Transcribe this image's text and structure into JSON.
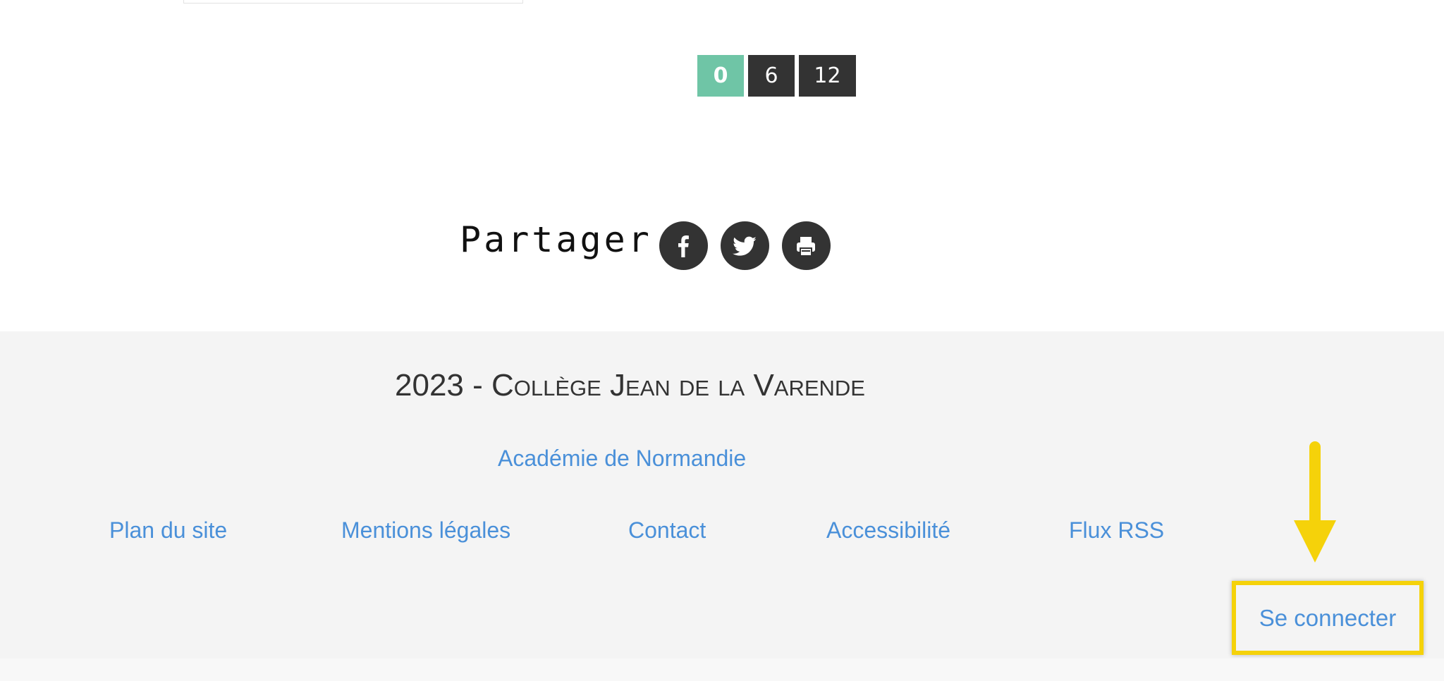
{
  "pagination": {
    "pages": [
      "0",
      "6",
      "12"
    ],
    "active_index": 0,
    "active_color": "#6fc5a6",
    "inactive_color": "#333333"
  },
  "share": {
    "label": "Partager",
    "icons": [
      "facebook-icon",
      "twitter-icon",
      "print-icon"
    ]
  },
  "footer": {
    "year_prefix": "2023 - ",
    "school_name": "Collège Jean de la Varende",
    "academie_link": "Académie de Normandie",
    "links": [
      "Plan du site",
      "Mentions légales",
      "Contact",
      "Accessibilité",
      "Flux RSS"
    ],
    "login_label": "Se connecter",
    "link_color": "#4a90d9",
    "highlight_color": "#f5d20a"
  }
}
